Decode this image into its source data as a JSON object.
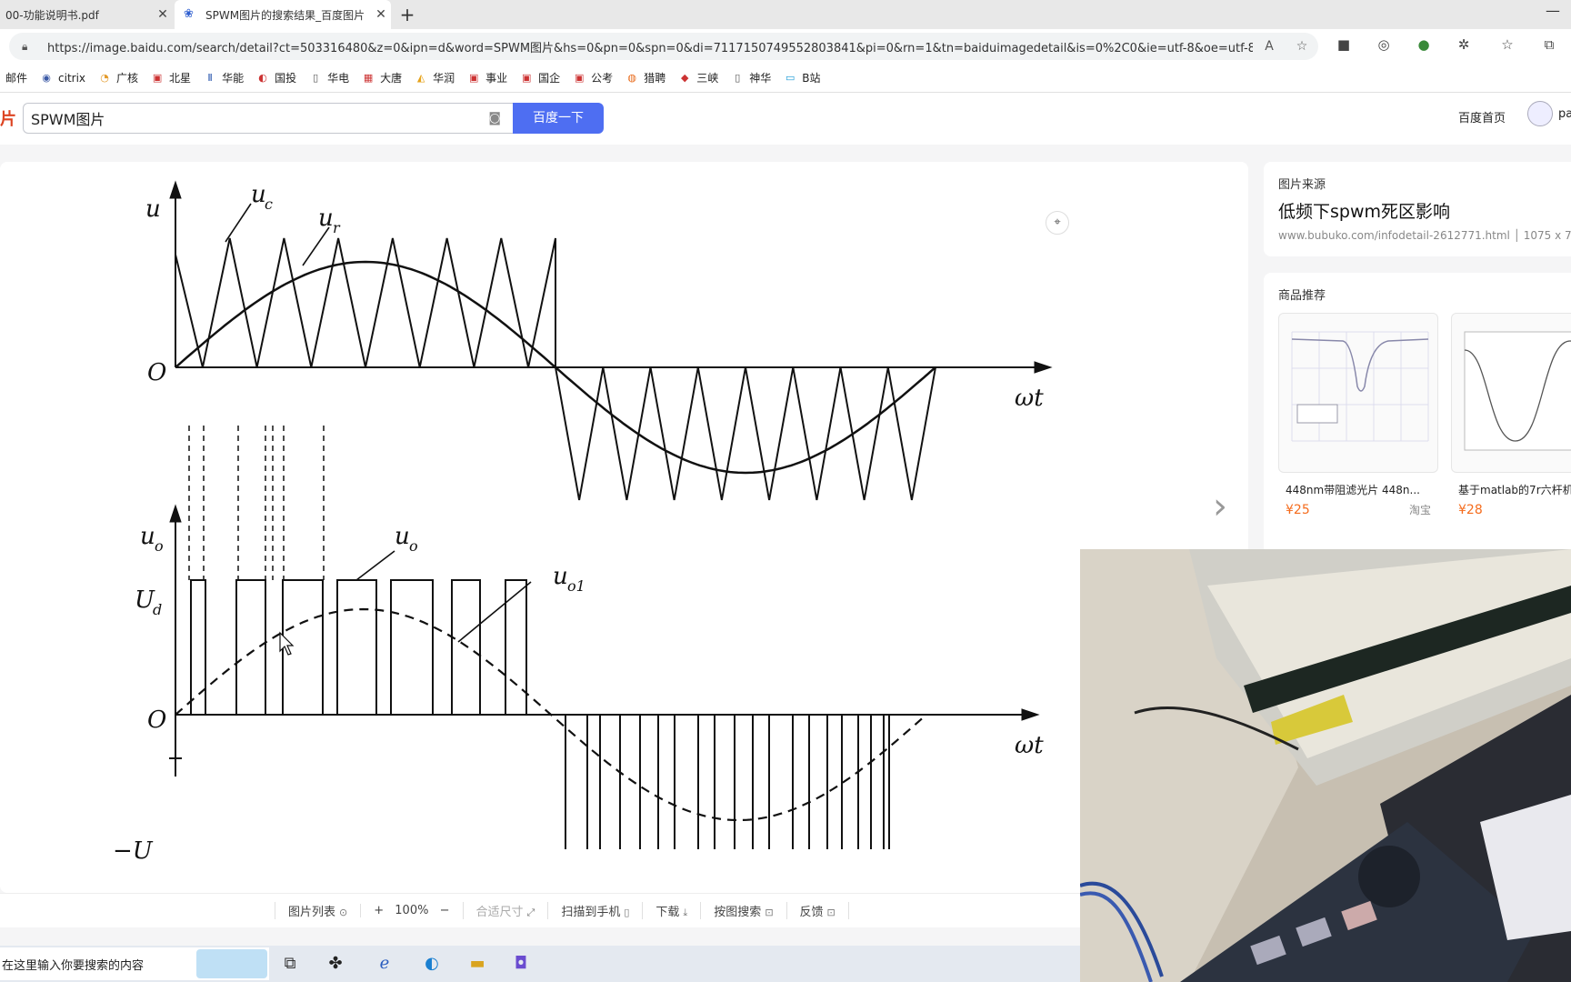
{
  "tabs": [
    {
      "label": "00-功能说明书.pdf",
      "active": false
    },
    {
      "label": "SPWM图片的搜索结果_百度图片",
      "active": true
    }
  ],
  "address": {
    "url": "https://image.baidu.com/search/detail?ct=503316480&z=0&ipn=d&word=SPWM图片&hs=0&pn=0&spn=0&di=7117150749552803841&pi=0&rn=1&tn=baiduimagedetail&is=0%2C0&ie=utf-8&oe=utf-8&cl=2..."
  },
  "bookmarks": [
    "邮件",
    "citrix",
    "广核",
    "北星",
    "华能",
    "国投",
    "华电",
    "大唐",
    "华润",
    "事业",
    "国企",
    "公考",
    "猎聘",
    "三峡",
    "神华",
    "B站"
  ],
  "header": {
    "logo_fragment": "片",
    "search_value": "SPWM图片",
    "search_button": "百度一下",
    "home_link": "百度首页",
    "user_fragment": "pa"
  },
  "figure": {
    "top_axis_u": "u",
    "top_label_uc": "u",
    "top_label_uc_sub": "c",
    "top_label_ur": "u",
    "top_label_ur_sub": "r",
    "origin": "O",
    "wt": "ωt",
    "bottom_axis_uo": "u",
    "bottom_axis_uo_sub": "o",
    "bottom_label_uo": "u",
    "bottom_label_uo_sub": "o",
    "bottom_label_uo1": "u",
    "bottom_label_uo1_sub": "o1",
    "ud": "U",
    "ud_sub": "d",
    "neg_ud": "−U"
  },
  "toolbar": {
    "list": "图片列表",
    "zoom_in": "+",
    "zoom_level": "100%",
    "zoom_out": "−",
    "fit": "合适尺寸",
    "scan": "扫描到手机",
    "download": "下载",
    "search_by_image": "按图搜索",
    "feedback": "反馈"
  },
  "source": {
    "heading": "图片来源",
    "title": "低频下spwm死区影响",
    "url_line": "www.bubuko.com/infodetail-2612771.html │ 1075 x 7"
  },
  "goods": {
    "heading": "商品推荐",
    "items": [
      {
        "name": "448nm带阻滤光片 448n...",
        "price": "¥25",
        "shop": "淘宝"
      },
      {
        "name": "基于matlab的7r六杆机",
        "price": "¥28",
        "shop": ""
      }
    ]
  },
  "taskbar": {
    "search_placeholder": "在这里输入你要搜索的内容"
  },
  "colors": {
    "search_button": "#4e6ef2",
    "price": "#f56c1d"
  }
}
